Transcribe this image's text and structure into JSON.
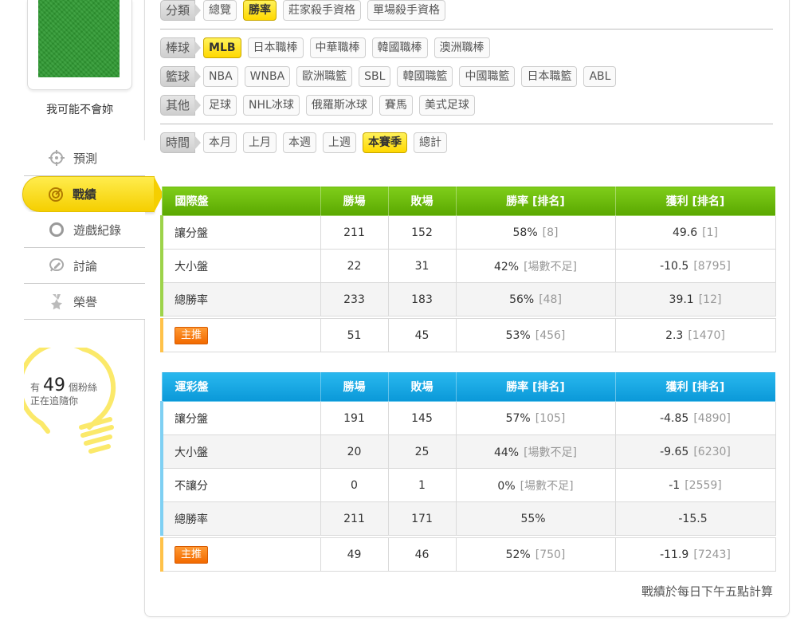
{
  "sidebar": {
    "username": "我可能不會妳",
    "nav": [
      {
        "label": "預測",
        "icon": "crosshair-icon"
      },
      {
        "label": "戰績",
        "icon": "target-icon",
        "active": true
      },
      {
        "label": "遊戲紀錄",
        "icon": "circle-icon"
      },
      {
        "label": "討論",
        "icon": "chat-pencil-icon"
      },
      {
        "label": "榮譽",
        "icon": "medal-icon"
      }
    ],
    "fans": {
      "prefix": "有",
      "count": "49",
      "suffix": "個粉絲",
      "line2": "正在追隨你"
    }
  },
  "filters": {
    "category": {
      "label": "分類",
      "options": [
        "總覽",
        "勝率",
        "莊家殺手資格",
        "單場殺手資格"
      ],
      "selected": "勝率"
    },
    "baseball": {
      "label": "棒球",
      "options": [
        "MLB",
        "日本職棒",
        "中華職棒",
        "韓國職棒",
        "澳洲職棒"
      ],
      "selected": "MLB"
    },
    "basketball": {
      "label": "籃球",
      "options": [
        "NBA",
        "WNBA",
        "歐洲職籃",
        "SBL",
        "韓國職籃",
        "中國職籃",
        "日本職籃",
        "ABL"
      ]
    },
    "other": {
      "label": "其他",
      "options": [
        "足球",
        "NHL冰球",
        "俄羅斯冰球",
        "賽馬",
        "美式足球"
      ]
    },
    "time": {
      "label": "時間",
      "options": [
        "本月",
        "上月",
        "本週",
        "上週",
        "本賽季",
        "總計"
      ],
      "selected": "本賽季"
    }
  },
  "intl_table": {
    "headers": [
      "國際盤",
      "勝場",
      "敗場",
      "勝率 [排名]",
      "獲利 [排名]"
    ],
    "rows": [
      {
        "name": "讓分盤",
        "win": "211",
        "loss": "152",
        "rate": "58%",
        "rate_rank": "[8]",
        "profit": "49.6",
        "profit_rank": "[1]"
      },
      {
        "name": "大小盤",
        "win": "22",
        "loss": "31",
        "rate": "42%",
        "rate_rank": "[場數不足]",
        "profit": "-10.5",
        "profit_rank": "[8795]"
      },
      {
        "name": "總勝率",
        "win": "233",
        "loss": "183",
        "rate": "56%",
        "rate_rank": "[48]",
        "profit": "39.1",
        "profit_rank": "[12]"
      }
    ],
    "pick": {
      "badge": "主推",
      "win": "51",
      "loss": "45",
      "rate": "53%",
      "rate_rank": "[456]",
      "profit": "2.3",
      "profit_rank": "[1470]"
    }
  },
  "lottery_table": {
    "headers": [
      "運彩盤",
      "勝場",
      "敗場",
      "勝率 [排名]",
      "獲利 [排名]"
    ],
    "rows": [
      {
        "name": "讓分盤",
        "win": "191",
        "loss": "145",
        "rate": "57%",
        "rate_rank": "[105]",
        "profit": "-4.85",
        "profit_rank": "[4890]"
      },
      {
        "name": "大小盤",
        "win": "20",
        "loss": "25",
        "rate": "44%",
        "rate_rank": "[場數不足]",
        "profit": "-9.65",
        "profit_rank": "[6230]"
      },
      {
        "name": "不讓分",
        "win": "0",
        "loss": "1",
        "rate": "0%",
        "rate_rank": "[場數不足]",
        "profit": "-1",
        "profit_rank": "[2559]"
      },
      {
        "name": "總勝率",
        "win": "211",
        "loss": "171",
        "rate": "55%",
        "rate_rank": "",
        "profit": "-15.5",
        "profit_rank": ""
      }
    ],
    "pick": {
      "badge": "主推",
      "win": "49",
      "loss": "46",
      "rate": "52%",
      "rate_rank": "[750]",
      "profit": "-11.9",
      "profit_rank": "[7243]"
    }
  },
  "footer_note": "戰績於每日下午五點計算",
  "colors": {
    "accent_yellow": "#ffd800",
    "header_green": "#6bbd0b",
    "header_blue": "#14a7e3",
    "pick_orange": "#f57c12"
  }
}
